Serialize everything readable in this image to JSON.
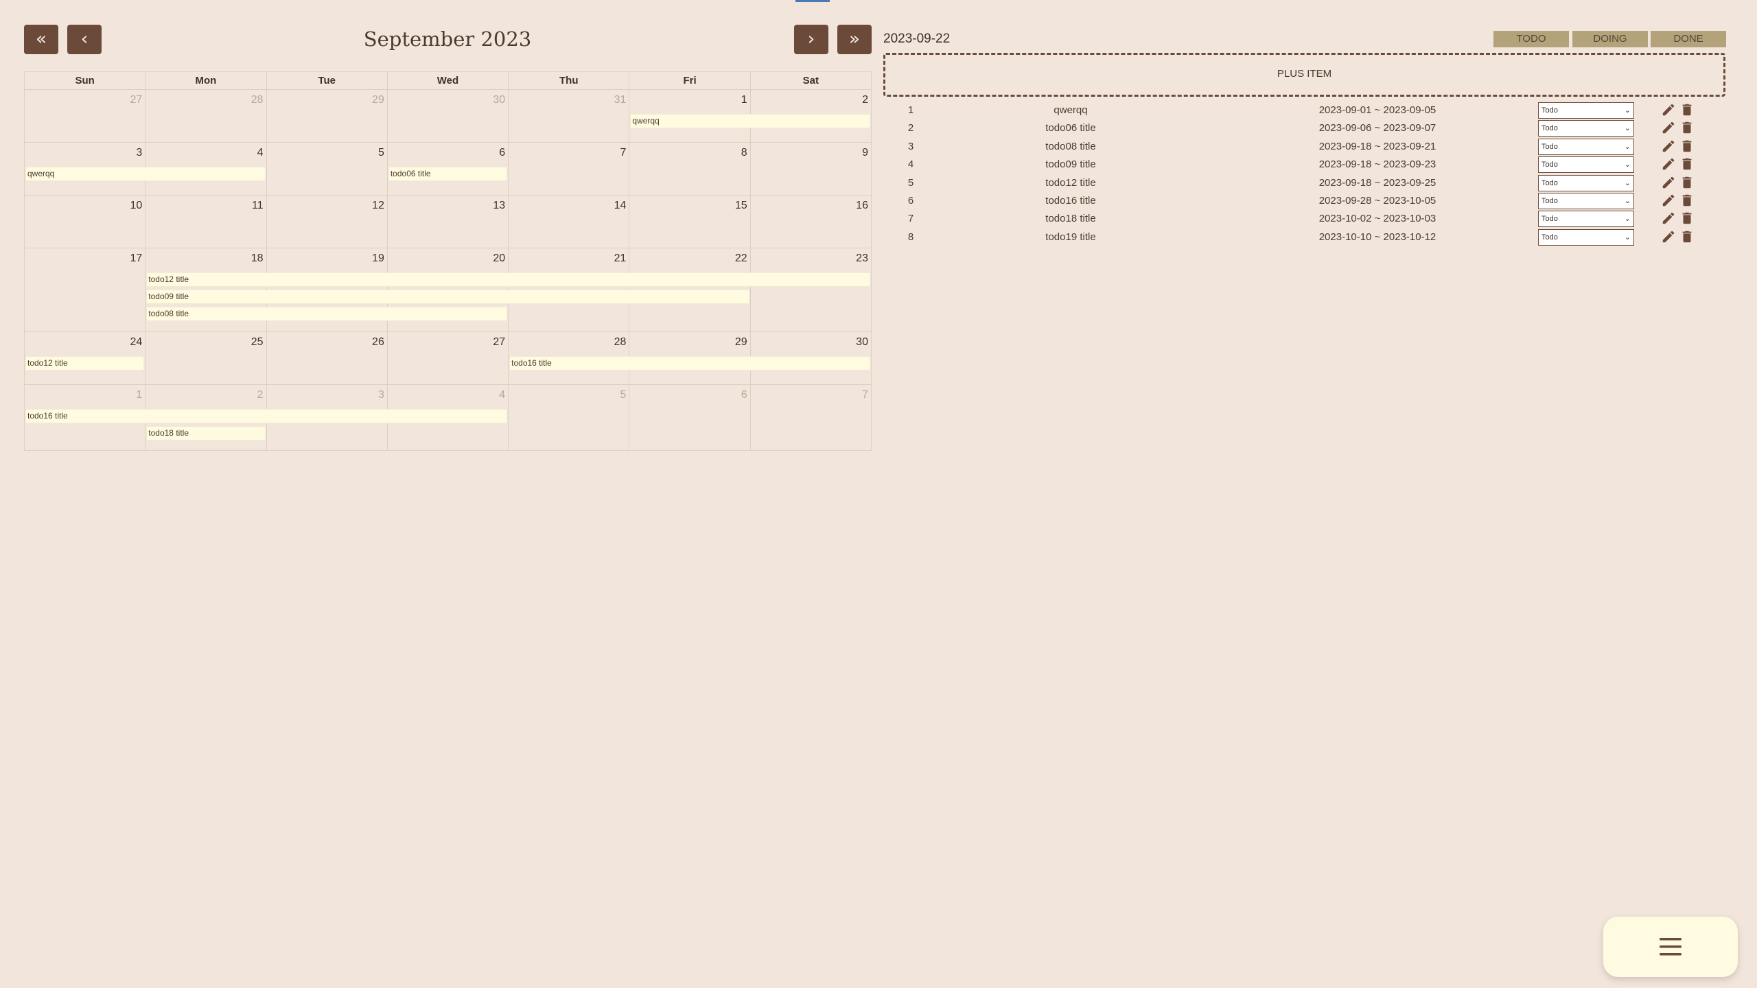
{
  "calendar": {
    "title": "September 2023",
    "nav": {
      "prev_year": "«",
      "prev_month": "‹",
      "next_month": "›",
      "next_year": "»"
    },
    "weekdays": [
      "Sun",
      "Mon",
      "Tue",
      "Wed",
      "Thu",
      "Fri",
      "Sat"
    ],
    "weeks": [
      {
        "days": [
          {
            "n": "27",
            "dim": true
          },
          {
            "n": "28",
            "dim": true
          },
          {
            "n": "29",
            "dim": true
          },
          {
            "n": "30",
            "dim": true
          },
          {
            "n": "31",
            "dim": true
          },
          {
            "n": "1"
          },
          {
            "n": "2"
          }
        ],
        "events": [
          {
            "label": "qwerqq",
            "start": 5,
            "end": 6,
            "lane": 0
          }
        ]
      },
      {
        "days": [
          {
            "n": "3"
          },
          {
            "n": "4"
          },
          {
            "n": "5"
          },
          {
            "n": "6"
          },
          {
            "n": "7"
          },
          {
            "n": "8"
          },
          {
            "n": "9"
          }
        ],
        "events": [
          {
            "label": "qwerqq",
            "start": 0,
            "end": 1,
            "lane": 0
          },
          {
            "label": "todo06 title",
            "start": 3,
            "end": 3,
            "lane": 0
          }
        ]
      },
      {
        "days": [
          {
            "n": "10"
          },
          {
            "n": "11"
          },
          {
            "n": "12"
          },
          {
            "n": "13"
          },
          {
            "n": "14"
          },
          {
            "n": "15"
          },
          {
            "n": "16"
          }
        ],
        "events": []
      },
      {
        "days": [
          {
            "n": "17"
          },
          {
            "n": "18"
          },
          {
            "n": "19"
          },
          {
            "n": "20"
          },
          {
            "n": "21"
          },
          {
            "n": "22"
          },
          {
            "n": "23"
          }
        ],
        "events": [
          {
            "label": "todo12 title",
            "start": 1,
            "end": 6,
            "lane": 0
          },
          {
            "label": "todo09 title",
            "start": 1,
            "end": 5,
            "lane": 1
          },
          {
            "label": "todo08 title",
            "start": 1,
            "end": 3,
            "lane": 2
          }
        ]
      },
      {
        "days": [
          {
            "n": "24"
          },
          {
            "n": "25"
          },
          {
            "n": "26"
          },
          {
            "n": "27"
          },
          {
            "n": "28"
          },
          {
            "n": "29"
          },
          {
            "n": "30"
          }
        ],
        "events": [
          {
            "label": "todo12 title",
            "start": 0,
            "end": 0,
            "lane": 0
          },
          {
            "label": "todo16 title",
            "start": 4,
            "end": 6,
            "lane": 0
          }
        ]
      },
      {
        "days": [
          {
            "n": "1",
            "dim": true
          },
          {
            "n": "2",
            "dim": true
          },
          {
            "n": "3",
            "dim": true
          },
          {
            "n": "4",
            "dim": true
          },
          {
            "n": "5",
            "dim": true
          },
          {
            "n": "6",
            "dim": true
          },
          {
            "n": "7",
            "dim": true
          }
        ],
        "events": [
          {
            "label": "todo16 title",
            "start": 0,
            "end": 3,
            "lane": 0
          },
          {
            "label": "todo18 title",
            "start": 1,
            "end": 1,
            "lane": 1
          }
        ]
      }
    ]
  },
  "panel": {
    "selected_date": "2023-09-22",
    "filters": [
      "TODO",
      "DOING",
      "DONE"
    ],
    "plus_item": "PLUS ITEM",
    "todos": [
      {
        "idx": "1",
        "title": "qwerqq",
        "range": "2023-09-01 ~ 2023-09-05",
        "status": "Todo"
      },
      {
        "idx": "2",
        "title": "todo06 title",
        "range": "2023-09-06 ~ 2023-09-07",
        "status": "Todo"
      },
      {
        "idx": "3",
        "title": "todo08 title",
        "range": "2023-09-18 ~ 2023-09-21",
        "status": "Todo"
      },
      {
        "idx": "4",
        "title": "todo09 title",
        "range": "2023-09-18 ~ 2023-09-23",
        "status": "Todo"
      },
      {
        "idx": "5",
        "title": "todo12 title",
        "range": "2023-09-18 ~ 2023-09-25",
        "status": "Todo"
      },
      {
        "idx": "6",
        "title": "todo16 title",
        "range": "2023-09-28 ~ 2023-10-05",
        "status": "Todo"
      },
      {
        "idx": "7",
        "title": "todo18 title",
        "range": "2023-10-02 ~ 2023-10-03",
        "status": "Todo"
      },
      {
        "idx": "8",
        "title": "todo19 title",
        "range": "2023-10-10 ~ 2023-10-12",
        "status": "Todo"
      }
    ]
  },
  "fab": {
    "icon": "menu-icon"
  },
  "colors": {
    "background": "#f2e6dc",
    "accent": "#6b4a39",
    "event_bar": "#fffbe0",
    "filter": "#b3a27a"
  }
}
